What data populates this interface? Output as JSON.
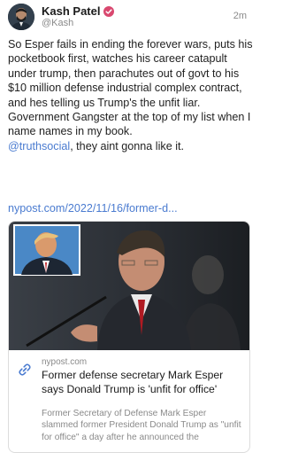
{
  "author": {
    "display_name": "Kash Patel",
    "handle": "@Kash",
    "time": "2m",
    "verified_icon": "verified-badge-icon",
    "verified_color": "#d9486f"
  },
  "post": {
    "text_before_mention": "So Esper fails in ending the forever wars, puts his pocketbook first, watches his career catapult under trump, then parachutes out of govt to his $10 million defense industrial complex contract, and hes telling us Trump's the unfit liar. Government Gangster at the top of my list when I name names in my book.",
    "mention": "@truthsocial",
    "text_after_mention": ", they aint gonna like it.",
    "link_text": "nypost.com/2022/11/16/former-d..."
  },
  "link_card": {
    "domain": "nypost.com",
    "title": "Former defense secretary Mark Esper says Donald Trump is 'unfit for office'",
    "description": "Former Secretary of Defense Mark Esper slammed former President Donald Trump as \"unfit for office\" a day after he announced the",
    "icon": "link-icon"
  },
  "colors": {
    "accent_link": "#4a7bd0",
    "muted_text": "#8a8a8a"
  }
}
